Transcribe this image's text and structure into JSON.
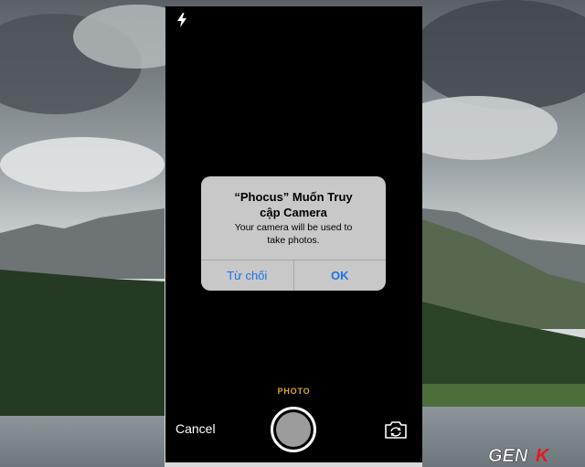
{
  "camera": {
    "mode_label": "PHOTO",
    "cancel_label": "Cancel",
    "flash_icon": "lightning-bolt-icon",
    "switch_icon": "camera-rotate-icon"
  },
  "alert": {
    "title": "“Phocus” Muốn Truy cập Camera",
    "message": "Your camera will be used to take photos.",
    "deny_label": "Từ chối",
    "ok_label": "OK",
    "button_color": "#1a73e8"
  },
  "watermark": {
    "text": "GENK",
    "accent": "#e41b23"
  }
}
